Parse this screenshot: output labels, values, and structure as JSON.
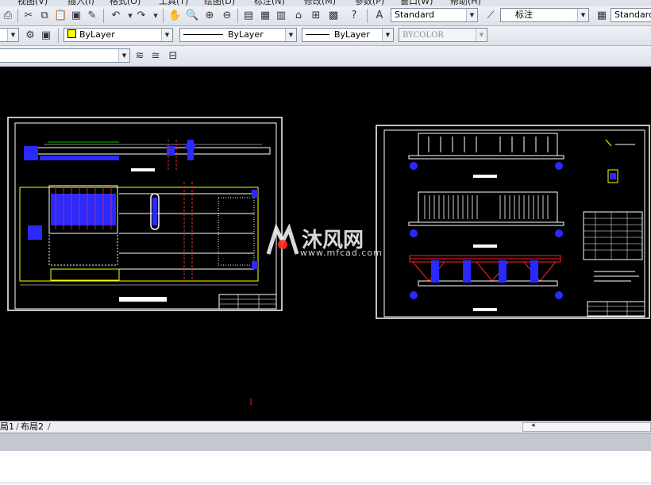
{
  "menu": {
    "items": [
      "视图(V)",
      "插入(I)",
      "格式(O)",
      "工具(T)",
      "绘图(D)",
      "标注(N)",
      "修改(M)",
      "参数(P)",
      "窗口(W)",
      "帮助(H)"
    ]
  },
  "toolbar": {
    "text_style_value": "Standard",
    "dim_style_value": "标注",
    "table_style_value": "Standard"
  },
  "properties": {
    "color_value": "ByLayer",
    "linetype_value": "ByLayer",
    "lineweight_value": "ByLayer",
    "plotstyle_value": "BYCOLOR",
    "accent_color": "#ffff00"
  },
  "layout_tabs": [
    "局1",
    "布局2"
  ],
  "watermark": {
    "brand": "沐风网",
    "url": "www.mfcad.com"
  },
  "colors": {
    "canvas": "#000000",
    "frame": "#ffffff",
    "pipe_yellow": "#ffff00",
    "equip_blue": "#2a2aff",
    "truss_red": "#ff2020",
    "note_green": "#00ff00"
  }
}
